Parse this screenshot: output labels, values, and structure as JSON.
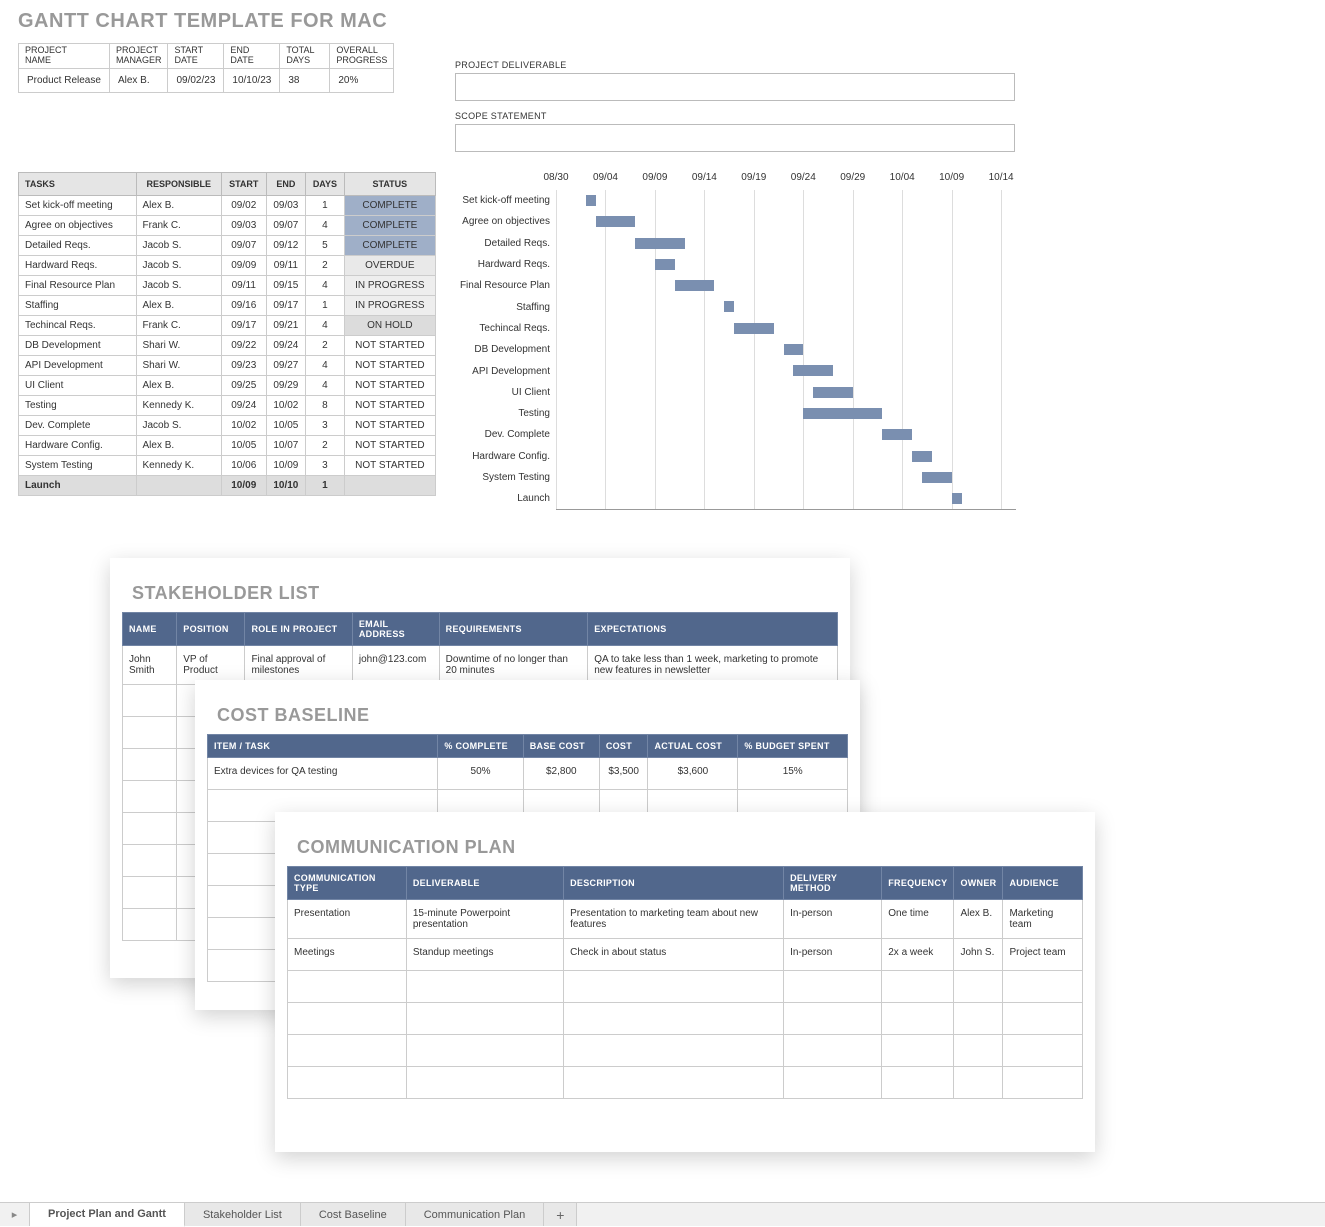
{
  "page_title": "GANTT CHART TEMPLATE FOR MAC",
  "attributes": {
    "headers": [
      "PROJECT\nNAME",
      "PROJECT\nMANAGER",
      "START\nDATE",
      "END\nDATE",
      "TOTAL\nDAYS",
      "OVERALL\nPROGRESS"
    ],
    "values": [
      "Product Release",
      "Alex B.",
      "09/02/23",
      "10/10/23",
      "38",
      "20%"
    ]
  },
  "right_fields": {
    "deliverable_label": "PROJECT DELIVERABLE",
    "scope_label": "SCOPE STATEMENT"
  },
  "tasks": {
    "headers": [
      "TASKS",
      "RESPONSIBLE",
      "START",
      "END",
      "DAYS",
      "STATUS"
    ],
    "rows": [
      {
        "task": "Set kick-off meeting",
        "resp": "Alex B.",
        "start": "09/02",
        "end": "09/03",
        "days": "1",
        "status": "COMPLETE",
        "cls": "status-complete"
      },
      {
        "task": "Agree on objectives",
        "resp": "Frank C.",
        "start": "09/03",
        "end": "09/07",
        "days": "4",
        "status": "COMPLETE",
        "cls": "status-complete"
      },
      {
        "task": "Detailed Reqs.",
        "resp": "Jacob S.",
        "start": "09/07",
        "end": "09/12",
        "days": "5",
        "status": "COMPLETE",
        "cls": "status-complete"
      },
      {
        "task": "Hardward Reqs.",
        "resp": "Jacob S.",
        "start": "09/09",
        "end": "09/11",
        "days": "2",
        "status": "OVERDUE",
        "cls": "status-overdue"
      },
      {
        "task": "Final Resource Plan",
        "resp": "Jacob S.",
        "start": "09/11",
        "end": "09/15",
        "days": "4",
        "status": "IN PROGRESS",
        "cls": "status-inprogress"
      },
      {
        "task": "Staffing",
        "resp": "Alex B.",
        "start": "09/16",
        "end": "09/17",
        "days": "1",
        "status": "IN PROGRESS",
        "cls": "status-inprogress"
      },
      {
        "task": "Techincal Reqs.",
        "resp": "Frank C.",
        "start": "09/17",
        "end": "09/21",
        "days": "4",
        "status": "ON HOLD",
        "cls": "status-onhold"
      },
      {
        "task": "DB Development",
        "resp": "Shari W.",
        "start": "09/22",
        "end": "09/24",
        "days": "2",
        "status": "NOT STARTED",
        "cls": ""
      },
      {
        "task": "API Development",
        "resp": "Shari W.",
        "start": "09/23",
        "end": "09/27",
        "days": "4",
        "status": "NOT STARTED",
        "cls": ""
      },
      {
        "task": "UI Client",
        "resp": "Alex B.",
        "start": "09/25",
        "end": "09/29",
        "days": "4",
        "status": "NOT STARTED",
        "cls": ""
      },
      {
        "task": "Testing",
        "resp": "Kennedy K.",
        "start": "09/24",
        "end": "10/02",
        "days": "8",
        "status": "NOT STARTED",
        "cls": ""
      },
      {
        "task": "Dev. Complete",
        "resp": "Jacob S.",
        "start": "10/02",
        "end": "10/05",
        "days": "3",
        "status": "NOT STARTED",
        "cls": ""
      },
      {
        "task": "Hardware Config.",
        "resp": "Alex B.",
        "start": "10/05",
        "end": "10/07",
        "days": "2",
        "status": "NOT STARTED",
        "cls": ""
      },
      {
        "task": "System Testing",
        "resp": "Kennedy K.",
        "start": "10/06",
        "end": "10/09",
        "days": "3",
        "status": "NOT STARTED",
        "cls": ""
      },
      {
        "task": "Launch",
        "resp": "",
        "start": "10/09",
        "end": "10/10",
        "days": "1",
        "status": "",
        "cls": "",
        "launch": true
      }
    ]
  },
  "chart_data": {
    "type": "gantt",
    "title": "",
    "x_start": "08/30",
    "x_end": "10/14",
    "tick_labels": [
      "08/30",
      "09/04",
      "09/09",
      "09/14",
      "09/19",
      "09/24",
      "09/29",
      "10/04",
      "10/09",
      "10/14"
    ],
    "tasks": [
      {
        "name": "Set kick-off meeting",
        "start_daynum": 3,
        "duration": 1
      },
      {
        "name": "Agree on objectives",
        "start_daynum": 4,
        "duration": 4
      },
      {
        "name": "Detailed Reqs.",
        "start_daynum": 8,
        "duration": 5
      },
      {
        "name": "Hardward Reqs.",
        "start_daynum": 10,
        "duration": 2
      },
      {
        "name": "Final Resource Plan",
        "start_daynum": 12,
        "duration": 4
      },
      {
        "name": "Staffing",
        "start_daynum": 17,
        "duration": 1
      },
      {
        "name": "Techincal Reqs.",
        "start_daynum": 18,
        "duration": 4
      },
      {
        "name": "DB Development",
        "start_daynum": 23,
        "duration": 2
      },
      {
        "name": "API Development",
        "start_daynum": 24,
        "duration": 4
      },
      {
        "name": "UI Client",
        "start_daynum": 26,
        "duration": 4
      },
      {
        "name": "Testing",
        "start_daynum": 25,
        "duration": 8
      },
      {
        "name": "Dev. Complete",
        "start_daynum": 33,
        "duration": 3
      },
      {
        "name": "Hardware Config.",
        "start_daynum": 36,
        "duration": 2
      },
      {
        "name": "System Testing",
        "start_daynum": 37,
        "duration": 3
      },
      {
        "name": "Launch",
        "start_daynum": 40,
        "duration": 1
      }
    ],
    "total_days": 46,
    "bar_color": "#7a8fb0"
  },
  "stakeholder": {
    "title": "STAKEHOLDER LIST",
    "headers": [
      "NAME",
      "POSITION",
      "ROLE IN PROJECT",
      "EMAIL ADDRESS",
      "REQUIREMENTS",
      "EXPECTATIONS"
    ],
    "rows": [
      [
        "John Smith",
        "VP of Product",
        "Final approval of milestones",
        "john@123.com",
        "Downtime of no longer than 20 minutes",
        "QA to take less than 1 week, marketing to promote new features in newsletter"
      ]
    ]
  },
  "cost": {
    "title": "COST BASELINE",
    "headers": [
      "ITEM / TASK",
      "% COMPLETE",
      "BASE COST",
      "COST",
      "ACTUAL COST",
      "% BUDGET SPENT"
    ],
    "rows": [
      [
        "Extra devices for QA testing",
        "50%",
        "$2,800",
        "$3,500",
        "$3,600",
        "15%"
      ]
    ]
  },
  "comm": {
    "title": "COMMUNICATION PLAN",
    "headers": [
      "COMMUNICATION TYPE",
      "DELIVERABLE",
      "DESCRIPTION",
      "DELIVERY METHOD",
      "FREQUENCY",
      "OWNER",
      "AUDIENCE"
    ],
    "rows": [
      [
        "Presentation",
        "15-minute Powerpoint presentation",
        "Presentation to marketing team about new features",
        "In-person",
        "One time",
        "Alex B.",
        "Marketing team"
      ],
      [
        "Meetings",
        "Standup meetings",
        "Check in about status",
        "In-person",
        "2x a week",
        "John S.",
        "Project team"
      ]
    ]
  },
  "tabs": {
    "items": [
      "Project Plan and Gantt",
      "Stakeholder List",
      "Cost Baseline",
      "Communication Plan"
    ],
    "active": 0
  }
}
